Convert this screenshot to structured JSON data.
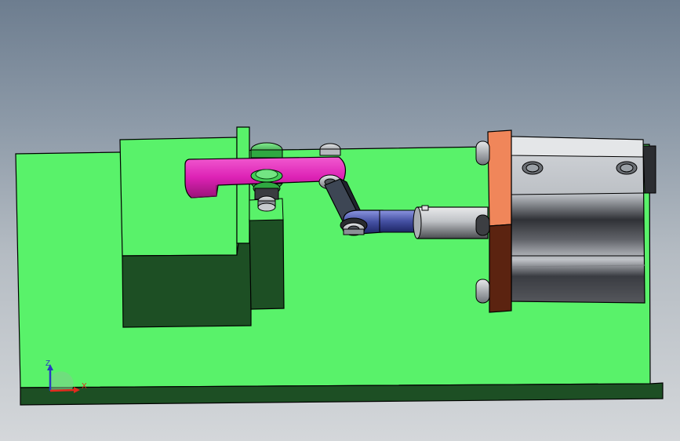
{
  "viewport": {
    "background_top": "#6d7d8f",
    "background_bottom": "#d4d7da"
  },
  "model": {
    "base_plate_color": "#59f26a",
    "base_plate_shadow_color": "#1d4f24",
    "clamp_arm_color": "#dd22b5",
    "link_color": "#3d4654",
    "rod_end_color": "#4450a2",
    "cylinder_flange_color": "#f0865a",
    "cylinder_flange_side_color": "#5b2310",
    "cylinder_body_color": "#c9cbce",
    "bolt_color": "#9ea4ab",
    "pivot_color": "#3dbf50"
  },
  "triad": {
    "x_label": "X",
    "z_label": "Z",
    "x_color": "#e12a1e",
    "z_color": "#283bc0"
  }
}
